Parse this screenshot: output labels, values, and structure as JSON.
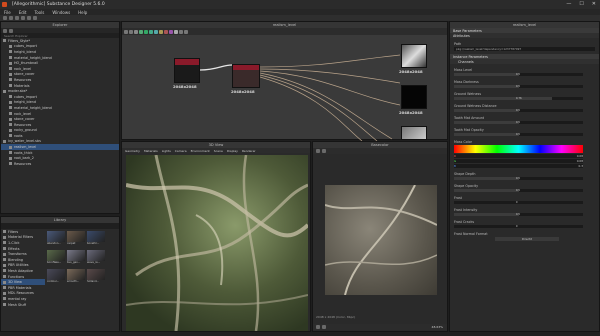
{
  "app": {
    "title": "[Allegorithmic] Substance Designer 5.6.0",
    "win_buttons": [
      "—",
      "☐",
      "✕"
    ]
  },
  "menu": [
    "File",
    "Edit",
    "Tools",
    "Windows",
    "Help"
  ],
  "explorer": {
    "title": "Explorer",
    "filter_label": "Search Explorer",
    "items": [
      {
        "label": "Filters_Style*",
        "level": 0
      },
      {
        "label": "cubes_import",
        "level": 1
      },
      {
        "label": "height_blend",
        "level": 1
      },
      {
        "label": "material_height_blend",
        "level": 1
      },
      {
        "label": "HO_thumbnail",
        "level": 1
      },
      {
        "label": "rock_level",
        "level": 1
      },
      {
        "label": "stone_cover",
        "level": 1
      },
      {
        "label": "Resources",
        "level": 1
      },
      {
        "label": "Materials",
        "level": 1
      },
      {
        "label": "moder.sbs*",
        "level": 0
      },
      {
        "label": "cubes_import",
        "level": 1
      },
      {
        "label": "height_blend",
        "level": 1
      },
      {
        "label": "material_height_blend",
        "level": 1
      },
      {
        "label": "rock_level",
        "level": 1
      },
      {
        "label": "stone_cover",
        "level": 1
      },
      {
        "label": "Resources",
        "level": 1
      },
      {
        "label": "rocky_ground",
        "level": 1
      },
      {
        "label": "roots",
        "level": 1
      },
      {
        "label": "ivy_water_level.sbs",
        "level": 0
      },
      {
        "label": "realism_level",
        "level": 1
      },
      {
        "label": "roots_thick",
        "level": 1
      },
      {
        "label": "root_bark_2",
        "level": 1
      },
      {
        "label": "Resources",
        "level": 1
      }
    ]
  },
  "library": {
    "title": "Library",
    "categories": [
      "Filters",
      "Material Filters",
      "1-Click",
      "Effects",
      "Transforms",
      "Blending",
      "PBR Utilities",
      "Mesh Adaptive",
      "Functions",
      "3D View",
      "PBR Materials",
      "MDL Resources",
      "mental ray",
      "Mesh Stuff"
    ],
    "thumb_labels": [
      "abandon...",
      "carpet",
      "bonefor...",
      "borofless...",
      "bus_gen...",
      "wave_re...",
      "contour...",
      "smooth...",
      "holland..."
    ]
  },
  "graph": {
    "title": "realism_level",
    "nodes": [
      {
        "label": "2048x2048"
      },
      {
        "label": "2048x2048"
      },
      {
        "label": "2048x2048"
      },
      {
        "label": "2048x2048"
      }
    ]
  },
  "view3d": {
    "title": "3D View",
    "menu": [
      "Geometry",
      "Materials",
      "Lights",
      "Camera",
      "Environment",
      "Scene",
      "Display",
      "Renderer"
    ]
  },
  "view2d": {
    "title": "Basecolor",
    "status": "2048 x 2048 (Color, 8bpc)",
    "zoom": "48.63%"
  },
  "params": {
    "title": "realism_level",
    "section1": "Base Parameters",
    "attributes": "Attributes",
    "path_label": "Path",
    "path_value": "pkg://realism_level?dependency=1237787097",
    "section2": "Instance Parameters",
    "group": "Channels",
    "sliders": [
      {
        "label": "Moss Level",
        "value": "0.5",
        "fill": 0.5
      },
      {
        "label": "Moss Darkness",
        "value": "0.5",
        "fill": 0.5
      },
      {
        "label": "Ground Wetness",
        "value": "0.76",
        "fill": 0.76
      },
      {
        "label": "Ground Wetness Distance",
        "value": "0.5",
        "fill": 0.5
      },
      {
        "label": "Tooth Mat Amount",
        "value": "0.5",
        "fill": 0.5
      },
      {
        "label": "Tooth Mat Opacity",
        "value": "0.5",
        "fill": 0.5
      }
    ],
    "color_label": "Moss Color",
    "color_values": [
      "0.08",
      "0.08",
      "0.3"
    ],
    "sliders2": [
      {
        "label": "Shape Depth",
        "value": "0.5",
        "fill": 0.5
      },
      {
        "label": "Shape Opacity",
        "value": "0.5",
        "fill": 0.5
      },
      {
        "label": "Frost",
        "value": "0",
        "fill": 0.0
      },
      {
        "label": "Frost Intensity",
        "value": "0.5",
        "fill": 0.5
      },
      {
        "label": "Frost Cracks",
        "value": "0",
        "fill": 0.0
      }
    ],
    "normal_label": "Frost Normal Format",
    "normal_value": "DirectX"
  }
}
